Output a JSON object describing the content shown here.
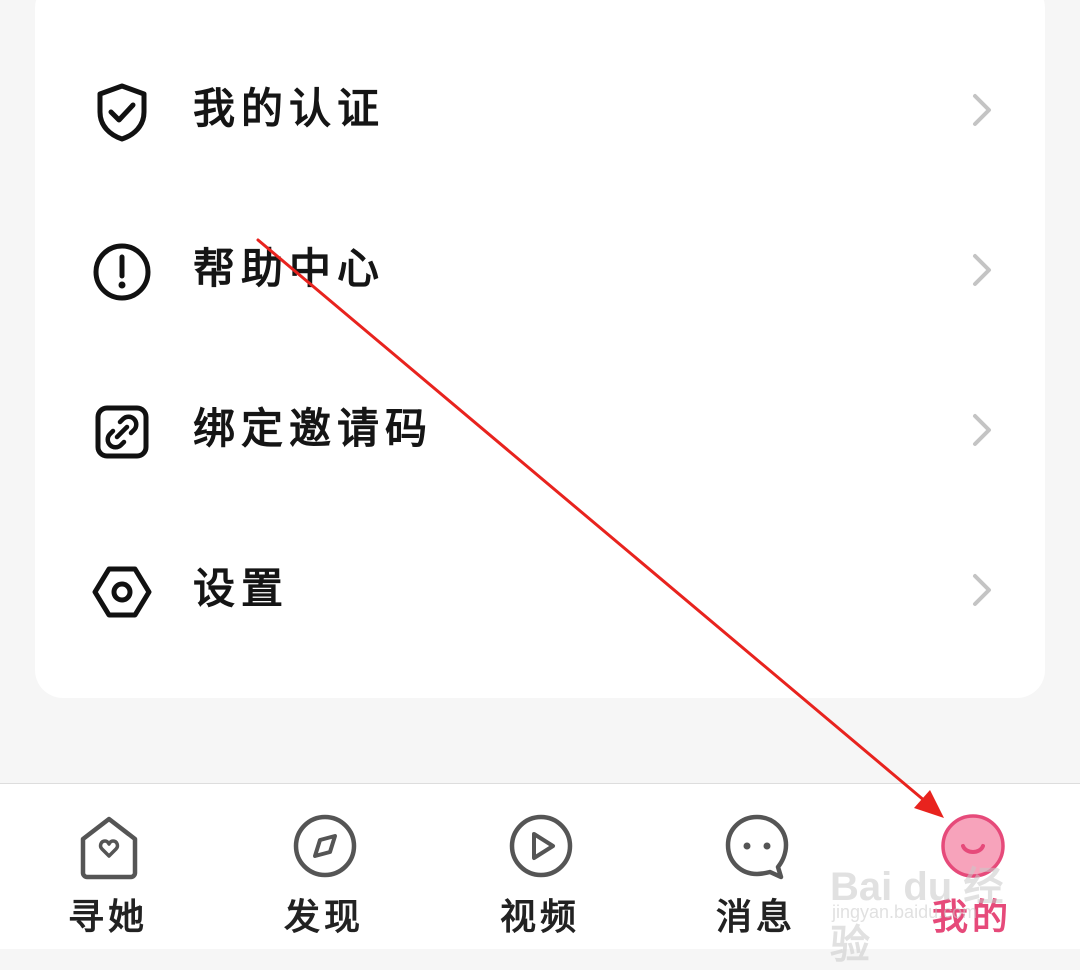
{
  "menu": {
    "items": [
      {
        "label": "我的认证",
        "icon": "shield-check-icon"
      },
      {
        "label": "帮助中心",
        "icon": "exclamation-circle-icon"
      },
      {
        "label": "绑定邀请码",
        "icon": "link-icon"
      },
      {
        "label": "设置",
        "icon": "settings-hexagon-icon"
      }
    ]
  },
  "tabbar": {
    "tabs": [
      {
        "label": "寻她",
        "icon": "house-heart-icon",
        "active": false
      },
      {
        "label": "发现",
        "icon": "compass-icon",
        "active": false
      },
      {
        "label": "视频",
        "icon": "play-circle-icon",
        "active": false
      },
      {
        "label": "消息",
        "icon": "chat-bubble-icon",
        "active": false
      },
      {
        "label": "我的",
        "icon": "smile-face-icon",
        "active": true
      }
    ]
  },
  "watermark": {
    "brand": "Bai du 经验",
    "url": "jingyan.baidu.com"
  },
  "colors": {
    "accent": "#e64a7a",
    "accent_fill": "#f7a3bb",
    "annotation_arrow": "#e8231e",
    "chevron": "#c4c4c4"
  }
}
